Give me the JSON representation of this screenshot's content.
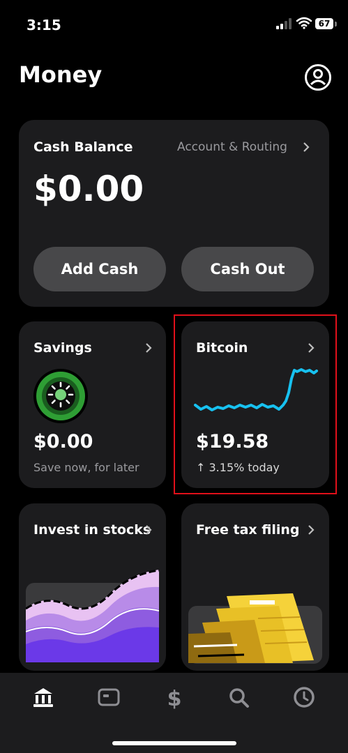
{
  "status_bar": {
    "time": "3:15",
    "battery_level": "67"
  },
  "page": {
    "title": "Money"
  },
  "cash_card": {
    "title": "Cash Balance",
    "link_label": "Account & Routing",
    "balance": "$0.00",
    "add_cash_label": "Add Cash",
    "cash_out_label": "Cash Out"
  },
  "savings_card": {
    "title": "Savings",
    "amount": "$0.00",
    "subtitle": "Save now, for later"
  },
  "bitcoin_card": {
    "title": "Bitcoin",
    "amount": "$19.58",
    "change": "↑ 3.15% today",
    "line_color": "#17c1f0"
  },
  "invest_card": {
    "title": "Invest in stocks"
  },
  "tax_card": {
    "title": "Free tax filing"
  },
  "tab_bar": {
    "items": [
      "home-icon",
      "card-icon",
      "dollar-icon",
      "search-icon",
      "clock-icon"
    ]
  }
}
